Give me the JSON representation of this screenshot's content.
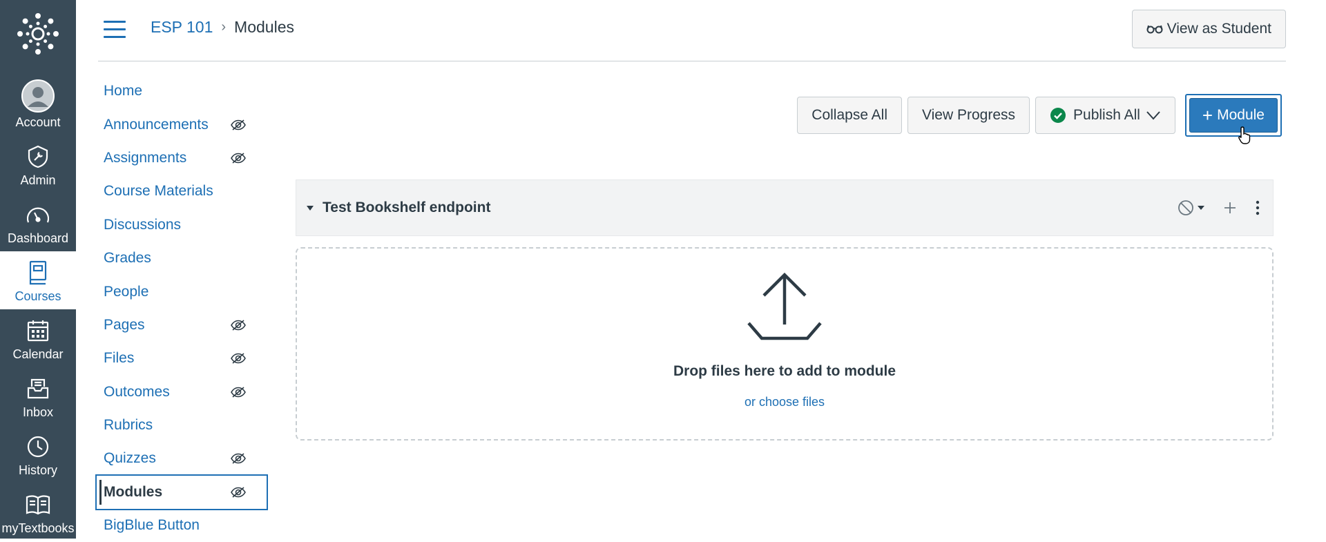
{
  "global_nav": {
    "items": [
      {
        "label": "Account",
        "icon": "account-icon"
      },
      {
        "label": "Admin",
        "icon": "admin-icon"
      },
      {
        "label": "Dashboard",
        "icon": "dashboard-icon"
      },
      {
        "label": "Courses",
        "icon": "courses-icon",
        "active": true
      },
      {
        "label": "Calendar",
        "icon": "calendar-icon"
      },
      {
        "label": "Inbox",
        "icon": "inbox-icon"
      },
      {
        "label": "History",
        "icon": "history-icon"
      },
      {
        "label": "myTextbooks",
        "icon": "textbooks-icon"
      }
    ]
  },
  "header": {
    "breadcrumb": {
      "course": "ESP 101",
      "separator": "›",
      "current": "Modules"
    },
    "view_as_student": "View as Student"
  },
  "course_nav": {
    "items": [
      {
        "label": "Home",
        "hidden": false
      },
      {
        "label": "Announcements",
        "hidden": true
      },
      {
        "label": "Assignments",
        "hidden": true
      },
      {
        "label": "Course Materials",
        "hidden": false
      },
      {
        "label": "Discussions",
        "hidden": false
      },
      {
        "label": "Grades",
        "hidden": false
      },
      {
        "label": "People",
        "hidden": false
      },
      {
        "label": "Pages",
        "hidden": true
      },
      {
        "label": "Files",
        "hidden": true
      },
      {
        "label": "Outcomes",
        "hidden": true
      },
      {
        "label": "Rubrics",
        "hidden": false
      },
      {
        "label": "Quizzes",
        "hidden": true
      },
      {
        "label": "Modules",
        "hidden": true,
        "active": true
      },
      {
        "label": "BigBlue Button",
        "hidden": false
      }
    ]
  },
  "toolbar": {
    "collapse_all": "Collapse All",
    "view_progress": "View Progress",
    "publish_all": "Publish All",
    "add_module_plus": "+",
    "add_module": "Module"
  },
  "module": {
    "title": "Test Bookshelf endpoint",
    "drop_text": "Drop files here to add to module",
    "choose_files": "or choose files"
  },
  "colors": {
    "nav_bg": "#394b58",
    "link": "#1d6fb4",
    "primary_button": "#2b7abc",
    "publish_check": "#0b874b"
  }
}
